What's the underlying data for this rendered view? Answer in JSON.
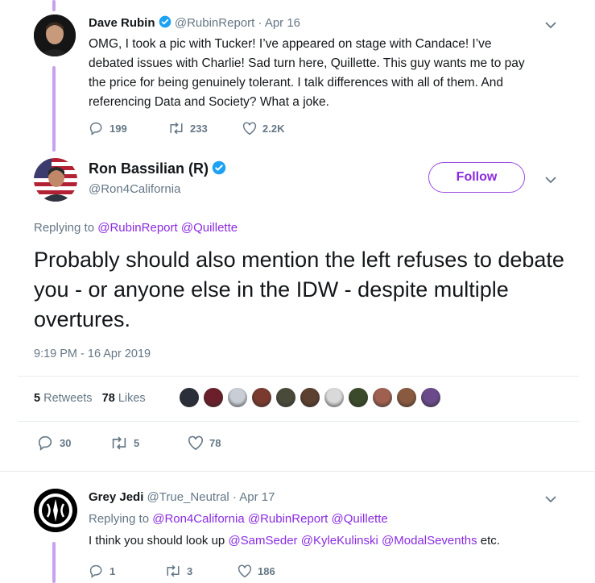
{
  "tweet1": {
    "name": "Dave Rubin",
    "handle": "@RubinReport",
    "date": "· Apr 16",
    "text": "OMG, I took a pic with Tucker! I’ve appeared on stage with Candace! I’ve debated issues with Charlie! Sad turn here, Quillette. This guy wants me to pay the price for being genuinely tolerant. I talk differences with all of them. And referencing Data and Society? What a joke.",
    "replies": "199",
    "retweets": "233",
    "likes": "2.2K"
  },
  "main_tweet": {
    "name": "Ron Bassilian (R)",
    "handle": "@Ron4California",
    "follow_label": "Follow",
    "replying_prefix": "Replying to",
    "replying_to": [
      "@RubinReport",
      "@Quillette"
    ],
    "text": "Probably should also mention the left refuses to debate you - or anyone else in the IDW - despite multiple overtures.",
    "timestamp": "9:19 PM - 16 Apr 2019",
    "retweet_count": "5",
    "retweet_label": "Retweets",
    "like_count": "78",
    "like_label": "Likes",
    "replies": "30",
    "retweets": "5",
    "likes": "78",
    "liker_colors": [
      "#2a2f3a",
      "#6b1f2a",
      "#c9ced6",
      "#7a3b2e",
      "#4a4a3a",
      "#5c4030",
      "#d9d9d9",
      "#3b4a2a",
      "#a06050",
      "#8a5a40",
      "#6a4a8a"
    ]
  },
  "reply_tweet": {
    "name": "Grey Jedi",
    "handle": "@True_Neutral",
    "date": "· Apr 17",
    "replying_prefix": "Replying to",
    "replying_to": [
      "@Ron4California",
      "@RubinReport",
      "@Quillette"
    ],
    "text_prefix": "I think you should look up",
    "mentions": [
      "@SamSeder",
      "@KyleKulinski",
      "@ModalSevenths"
    ],
    "text_suffix": "etc.",
    "replies": "1",
    "retweets": "3",
    "likes": "186"
  },
  "colors": {
    "accent": "#8a2be2",
    "thread": "#c9a0ec",
    "muted": "#657786",
    "verified": "#1da1f2"
  }
}
